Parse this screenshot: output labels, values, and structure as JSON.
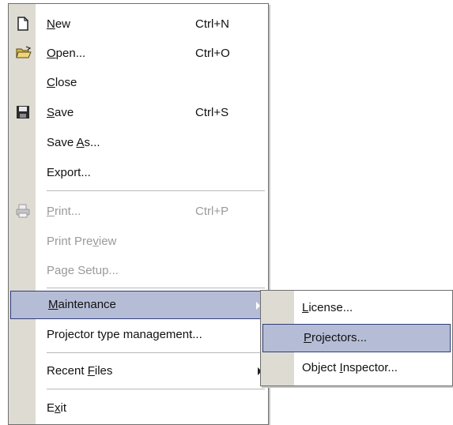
{
  "file_menu": {
    "items": [
      {
        "pre": "",
        "acc": "N",
        "post": "ew",
        "shortcut": "Ctrl+N",
        "icon": "new-document-icon",
        "disabled": false
      },
      {
        "pre": "",
        "acc": "O",
        "post": "pen...",
        "shortcut": "Ctrl+O",
        "icon": "open-folder-icon",
        "disabled": false
      },
      {
        "pre": "",
        "acc": "C",
        "post": "lose",
        "shortcut": "",
        "icon": "",
        "disabled": false
      },
      {
        "pre": "",
        "acc": "S",
        "post": "ave",
        "shortcut": "Ctrl+S",
        "icon": "save-disk-icon",
        "disabled": false
      },
      {
        "pre": "Save ",
        "acc": "A",
        "post": "s...",
        "shortcut": "",
        "icon": "",
        "disabled": false
      },
      {
        "pre": "Export...",
        "acc": "",
        "post": "",
        "shortcut": "",
        "icon": "",
        "disabled": false
      },
      {
        "pre": "",
        "acc": "P",
        "post": "rint...",
        "shortcut": "Ctrl+P",
        "icon": "printer-icon",
        "disabled": true
      },
      {
        "pre": "Print Pre",
        "acc": "v",
        "post": "iew",
        "shortcut": "",
        "icon": "",
        "disabled": true
      },
      {
        "pre": "Pa",
        "acc": "g",
        "post": "e Setup...",
        "shortcut": "",
        "icon": "",
        "disabled": true
      },
      {
        "pre": "",
        "acc": "M",
        "post": "aintenance",
        "shortcut": "",
        "icon": "",
        "disabled": false,
        "highlighted": true,
        "submenu": true
      },
      {
        "pre": "Projector type management...",
        "acc": "",
        "post": "",
        "shortcut": "",
        "icon": "",
        "disabled": false
      },
      {
        "pre": "Recent ",
        "acc": "F",
        "post": "iles",
        "shortcut": "",
        "icon": "",
        "disabled": false,
        "submenu": true
      },
      {
        "pre": "E",
        "acc": "x",
        "post": "it",
        "shortcut": "",
        "icon": "",
        "disabled": false
      }
    ]
  },
  "maintenance_submenu": {
    "items": [
      {
        "pre": "",
        "acc": "L",
        "post": "icense..."
      },
      {
        "pre": "",
        "acc": "P",
        "post": "rojectors...",
        "highlighted": true
      },
      {
        "pre": "Object ",
        "acc": "I",
        "post": "nspector..."
      }
    ]
  },
  "colors": {
    "gutter": "#dedbd3",
    "highlight": "#b5bdd6",
    "highlight_border": "#2f3f7a",
    "disabled_text": "#9a9a9a"
  }
}
